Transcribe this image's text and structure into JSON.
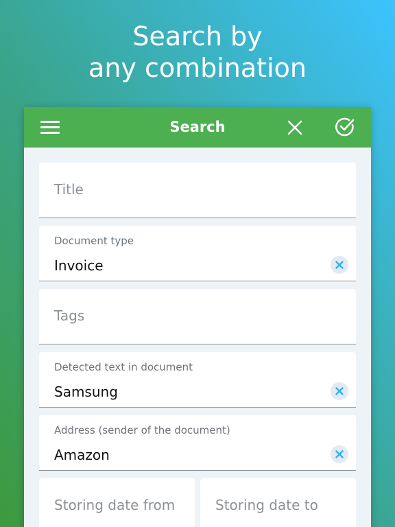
{
  "headline": {
    "line1": "Search by",
    "line2": "any combination"
  },
  "toolbar": {
    "title": "Search",
    "background": "#4caf50"
  },
  "fields": {
    "title": {
      "placeholder": "Title"
    },
    "document_type": {
      "label": "Document type",
      "value": "Invoice"
    },
    "tags": {
      "placeholder": "Tags"
    },
    "detected_text": {
      "label": "Detected text in document",
      "value": "Samsung"
    },
    "address": {
      "label": "Address (sender of the document)",
      "value": "Amazon"
    },
    "storing_date_from": {
      "placeholder": "Storing date from"
    },
    "storing_date_to": {
      "placeholder": "Storing date to"
    }
  },
  "colors": {
    "accent_clear": "#29b6f6",
    "panel_bg": "#eef3f8"
  },
  "icons": {
    "menu": "hamburger-menu-icon",
    "close": "close-icon",
    "confirm": "check-circle-icon",
    "clear": "clear-x-icon"
  }
}
